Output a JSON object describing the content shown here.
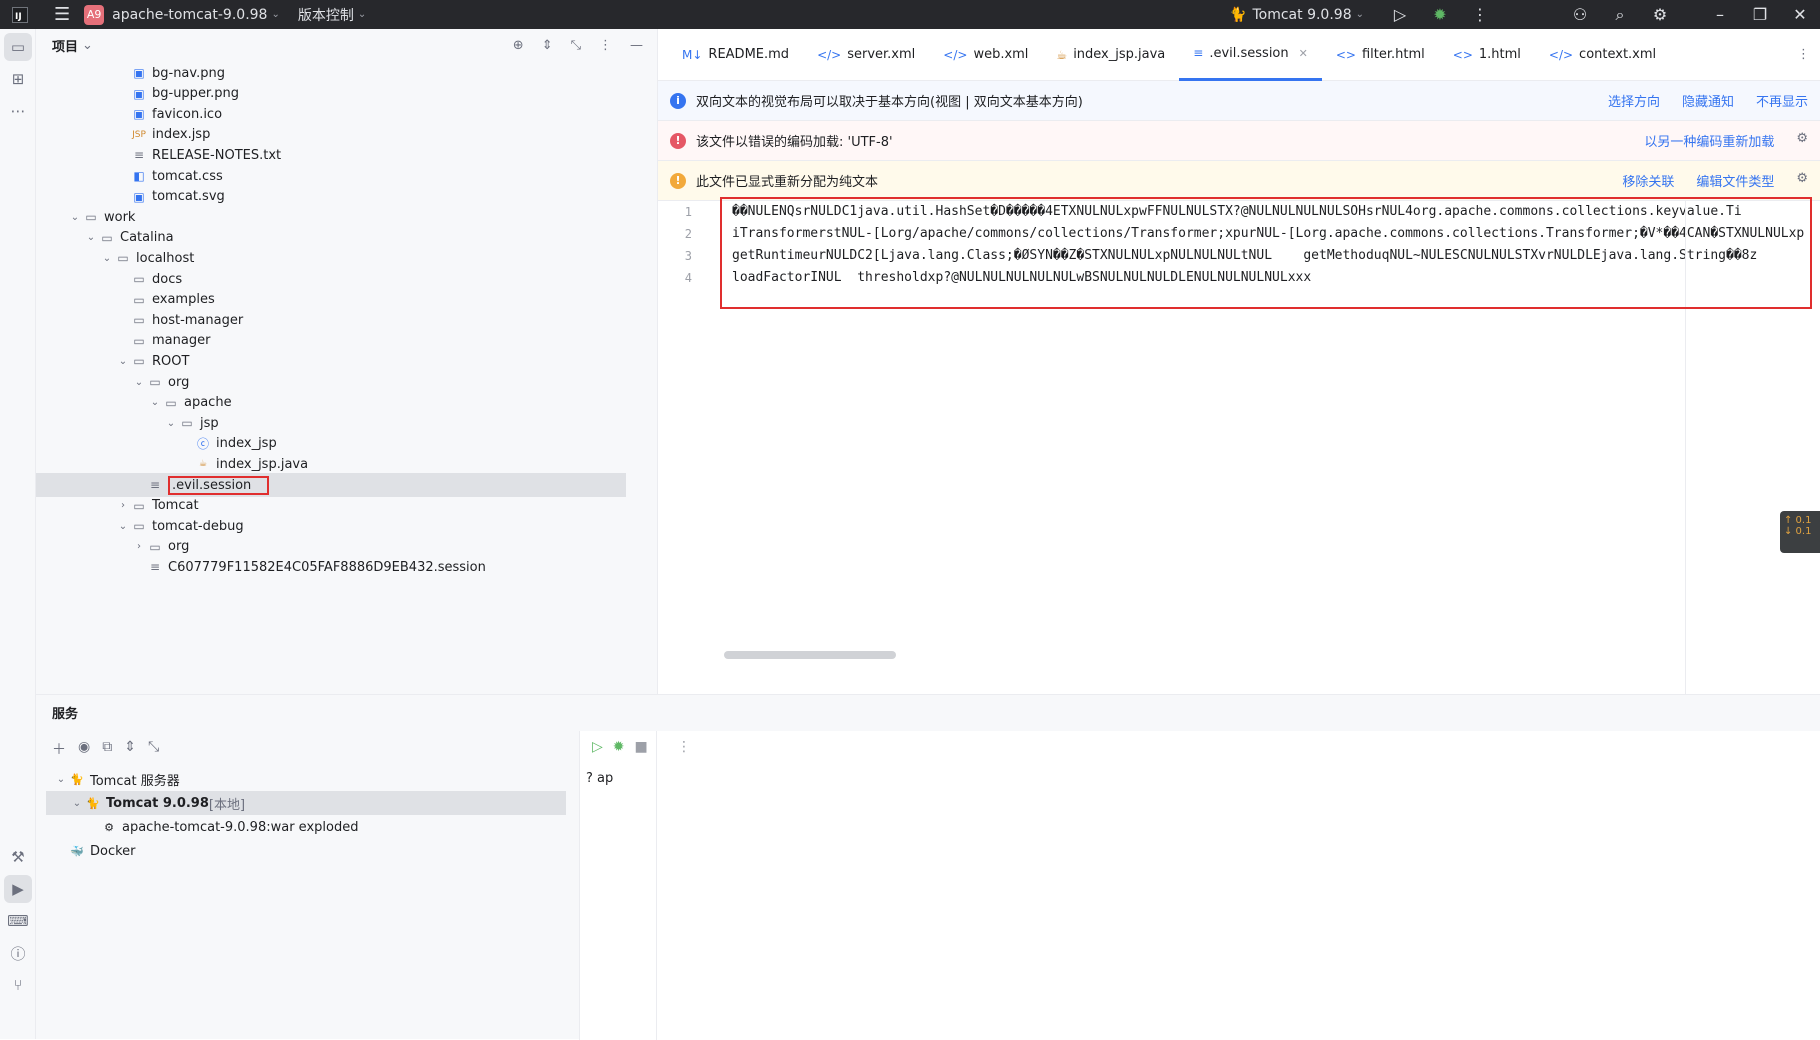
{
  "titlebar": {
    "project_badge": "A9",
    "project_name": "apache-tomcat-9.0.98",
    "vcs_menu": "版本控制",
    "run_config": "Tomcat 9.0.98"
  },
  "project_panel": {
    "title": "项目",
    "tree": [
      {
        "label": "bg-nav.png",
        "icon": "image-icon",
        "depth": 4
      },
      {
        "label": "bg-upper.png",
        "icon": "image-icon",
        "depth": 4
      },
      {
        "label": "favicon.ico",
        "icon": "image-icon",
        "depth": 4
      },
      {
        "label": "index.jsp",
        "icon": "jsp-icon",
        "depth": 4
      },
      {
        "label": "RELEASE-NOTES.txt",
        "icon": "text-icon",
        "depth": 4
      },
      {
        "label": "tomcat.css",
        "icon": "css-icon",
        "depth": 4
      },
      {
        "label": "tomcat.svg",
        "icon": "image-icon",
        "depth": 4
      },
      {
        "label": "work",
        "icon": "folder-icon",
        "depth": 1,
        "expanded": true
      },
      {
        "label": "Catalina",
        "icon": "folder-icon",
        "depth": 2,
        "expanded": true
      },
      {
        "label": "localhost",
        "icon": "folder-icon",
        "depth": 3,
        "expanded": true
      },
      {
        "label": "docs",
        "icon": "folder-icon",
        "depth": 4
      },
      {
        "label": "examples",
        "icon": "folder-icon",
        "depth": 4
      },
      {
        "label": "host-manager",
        "icon": "folder-icon",
        "depth": 4
      },
      {
        "label": "manager",
        "icon": "folder-icon",
        "depth": 4
      },
      {
        "label": "ROOT",
        "icon": "folder-icon",
        "depth": 4,
        "expanded": true
      },
      {
        "label": "org",
        "icon": "folder-icon",
        "depth": 5,
        "expanded": true
      },
      {
        "label": "apache",
        "icon": "folder-icon",
        "depth": 6,
        "expanded": true
      },
      {
        "label": "jsp",
        "icon": "folder-icon",
        "depth": 7,
        "expanded": true
      },
      {
        "label": "index_jsp",
        "icon": "class-icon",
        "depth": 8
      },
      {
        "label": "index_jsp.java",
        "icon": "java-icon",
        "depth": 8
      },
      {
        "label": ".evil.session",
        "icon": "text-icon",
        "depth": 5,
        "selected": true
      },
      {
        "label": "Tomcat",
        "icon": "folder-icon",
        "depth": 4,
        "collapsed": true
      },
      {
        "label": "tomcat-debug",
        "icon": "folder-icon",
        "depth": 4,
        "expanded": true
      },
      {
        "label": "org",
        "icon": "folder-icon",
        "depth": 5,
        "collapsed": true
      },
      {
        "label": "C607779F11582E4C05FAF8886D9EB432.session",
        "icon": "text-icon",
        "depth": 5
      }
    ]
  },
  "editor": {
    "tabs": [
      {
        "label": "README.md",
        "icon": "M↓"
      },
      {
        "label": "server.xml",
        "icon": "</>"
      },
      {
        "label": "web.xml",
        "icon": "</>"
      },
      {
        "label": "index_jsp.java",
        "icon": "☕"
      },
      {
        "label": ".evil.session",
        "icon": "≡",
        "active": true
      },
      {
        "label": "filter.html",
        "icon": "<>"
      },
      {
        "label": "1.html",
        "icon": "<>"
      },
      {
        "label": "context.xml",
        "icon": "</>"
      }
    ],
    "banners": [
      {
        "type": "info",
        "text": "双向文本的视觉布局可以取决于基本方向(视图 | 双向文本基本方向)",
        "links": [
          "选择方向",
          "隐藏通知",
          "不再显示"
        ]
      },
      {
        "type": "error",
        "text": "该文件以错误的编码加载: 'UTF-8'",
        "links": [
          "以另一种编码重新加载"
        ]
      },
      {
        "type": "warn",
        "text": "此文件已显式重新分配为纯文本",
        "links": [
          "移除关联",
          "编辑文件类型"
        ]
      }
    ],
    "lines": [
      {
        "num": "1",
        "text": "��NULENQsrNULDC1java.util.HashSet�D�����4ETXNULNULxpwFFNULNULSTX?@NULNULNULNULSOHsrNUL4org.apache.commons.collections.keyvalue.Ti"
      },
      {
        "num": "2",
        "text": "iTransformerstNUL-[Lorg/apache/commons/collections/Transformer;xpurNUL-[Lorg.apache.commons.collections.Transformer;�V*��4CAN�STXNULNULxp"
      },
      {
        "num": "3",
        "text": "getRuntimeurNULDC2[Ljava.lang.Class;�ØSYN��Z�STXNULNULxpNULNULNULtNUL    getMethoduqNUL~NULESCNULNULSTXvrNULDLEjava.lang.String��8z"
      },
      {
        "num": "4",
        "text": "loadFactorINUL  thresholdxp?@NULNULNULNULNULwBSNULNULNULDLENULNULNULNULxxx"
      }
    ],
    "side_badge": [
      "↑ 0.1",
      "↓ 0.1"
    ]
  },
  "services": {
    "title": "服务",
    "tree": [
      {
        "label": "Tomcat 服务器",
        "depth": 0
      },
      {
        "label": "Tomcat 9.0.98",
        "suffix": "[本地]",
        "depth": 1,
        "selected": true
      },
      {
        "label": "apache-tomcat-9.0.98:war exploded",
        "depth": 2
      },
      {
        "label": "Docker",
        "depth": 0
      }
    ],
    "mid_label": "ap"
  }
}
